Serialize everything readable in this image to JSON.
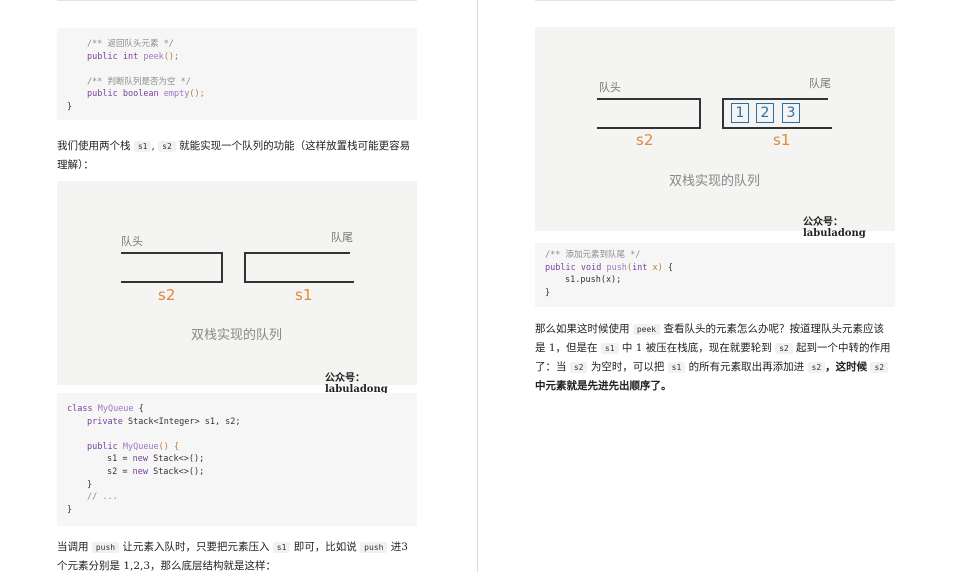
{
  "left": {
    "code_top": {
      "lines": [
        {
          "comment": "/** 返回队头元素 */"
        },
        {
          "kw": "public",
          "type": "int",
          "fn": "peek",
          "parens": "();"
        },
        {
          "blank": true
        },
        {
          "comment": "/** 判断队列是否为空 */"
        },
        {
          "kw": "public",
          "type": "boolean",
          "fn": "empty",
          "parens": "();"
        },
        {
          "close": "}"
        }
      ]
    },
    "para1": {
      "before": "我们使用两个栈",
      "s1": "s1",
      "sep": ",",
      "s2": "s2",
      "after": "就能实现一个队列的功能（这样放置栈可能更容易理解）："
    },
    "figure": {
      "label_head": "队头",
      "label_tail": "队尾",
      "s2": "s2",
      "s1": "s1",
      "caption": "双栈实现的队列",
      "credit": "公众号：labuladong"
    },
    "code_class": {
      "l1_kw": "class",
      "l1_name": "MyQueue",
      "l1_brace": "{",
      "l2_kw": "private",
      "l2_rest": "Stack<Integer> s1, s2;",
      "l4_kw": "public",
      "l4_fn": "MyQueue",
      "l4_rest": "() {",
      "l5_a": "s1 = ",
      "l5_kw": "new",
      "l5_b": " Stack<>();",
      "l6_a": "s2 = ",
      "l6_kw": "new",
      "l6_b": " Stack<>();",
      "l7": "}",
      "l8": "// ...",
      "l9": "}"
    },
    "para2": {
      "t1": "当调用",
      "push1": "push",
      "t2": "让元素入队时，只要把元素压入",
      "s1": "s1",
      "t3": "即可，比如说",
      "push2": "push",
      "t4": "进3 个元素分别是 1,2,3，那么底层结构就是这样："
    }
  },
  "right": {
    "figure": {
      "label_head": "队头",
      "label_tail": "队尾",
      "s2": "s2",
      "s1": "s1",
      "boxes": [
        "1",
        "2",
        "3"
      ],
      "caption": "双栈实现的队列",
      "credit": "公众号：labuladong"
    },
    "code_push": {
      "comment": "/** 添加元素到队尾 */",
      "kw": "public",
      "type": "void",
      "fn": "push",
      "p_open": "(",
      "p_type": "int",
      "p_name": " x",
      "p_close": ")",
      "brace": " {",
      "body": "s1.push(x);",
      "close": "}"
    },
    "para3": {
      "t1": "那么如果这时候使用",
      "peek": "peek",
      "t2": "查看队头的元素怎么办呢？按道理队头元素应该是 1，但是在",
      "s1a": "s1",
      "t3": "中 1 被压在栈底，现在就要轮到",
      "s2a": "s2",
      "t4": "起到一个中转的作用了：当",
      "s2b": "s2",
      "t5": "为空时，可以把",
      "s1b": "s1",
      "t6": "的所有元素取出再添加进",
      "s2c": "s2",
      "t7": "，这时候",
      "s2d": "s2",
      "t8": "中元素就是先进先出顺序了。"
    }
  }
}
